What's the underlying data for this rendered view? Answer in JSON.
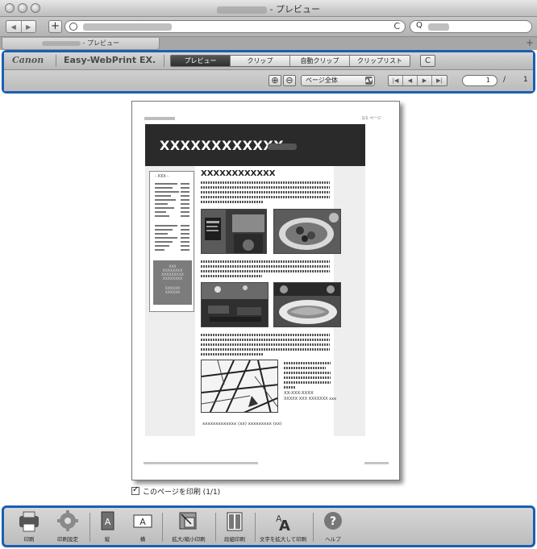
{
  "window": {
    "title": "- プレビュー",
    "tab_label": "- プレビュー"
  },
  "browser": {
    "reload_glyph": "C",
    "search_glyph": "Q"
  },
  "plugin": {
    "brand": "Canon",
    "product": "Easy-WebPrint EX.",
    "tabs": [
      "プレビュー",
      "クリップ",
      "自動クリップ",
      "クリップリスト"
    ],
    "active_tab": "プレビュー",
    "zoom_value": "ページ全体",
    "page_current": "1",
    "page_separator": "/",
    "page_total": "1"
  },
  "document": {
    "page_indicator": "1/1 ページ",
    "hero_title": "XXXXXXXXXXXX",
    "sidebar_heading": "- XXX -",
    "graybox_lines": [
      "XXX",
      "XXXXXXXX",
      "XXXXXXXXX",
      "XXXXXXXX",
      "",
      "XXXXXX",
      "XXXXXX"
    ],
    "main_heading": "XXXXXXXXXXXX",
    "map_caption_lines": [
      "XX-XXX-XXXX",
      "XXXXX XXX XXXXXXX xxx"
    ],
    "footer_caption": "xxxxxxxxxxxxx      (xx)  xxxxxxxxx  (xx)"
  },
  "print_checkbox": {
    "label": "このページを印刷 (1/1)",
    "checked": true
  },
  "bottom_toolbar": {
    "print": "印刷",
    "print_settings": "印刷設定",
    "portrait": "縦",
    "landscape": "横",
    "scale_print": "拡大/縮小印刷",
    "column_print": "段組印刷",
    "enlarge_text_print": "文字を拡大して印刷",
    "help": "ヘルプ"
  },
  "colors": {
    "accent_border": "#1a5fb4",
    "active_tab_bg": "#3a3a3a",
    "hero_bg": "#2a2a2a"
  }
}
